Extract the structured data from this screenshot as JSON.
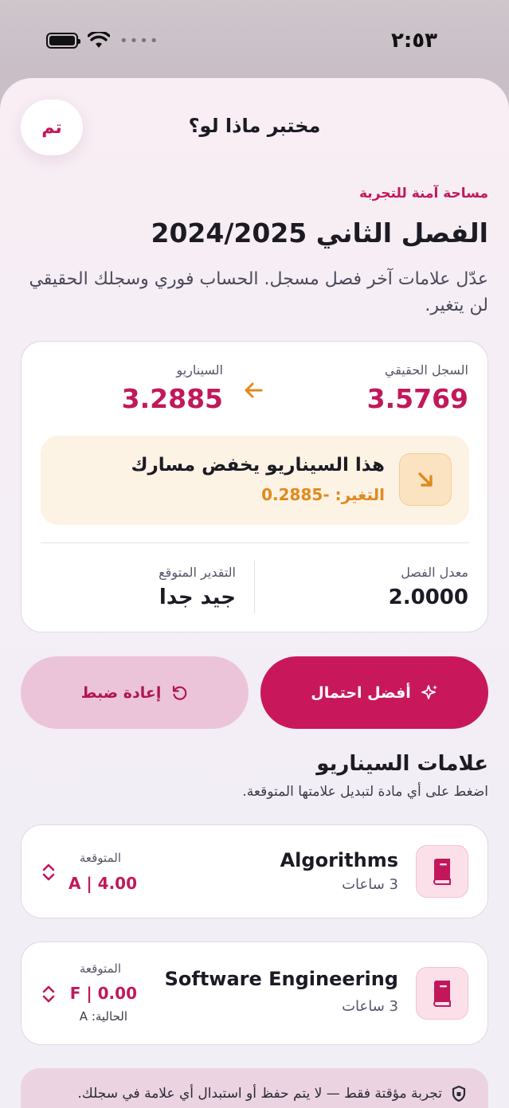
{
  "status": {
    "time": "٢:٥٣"
  },
  "header": {
    "done_label": "تم",
    "title": "مختبر ماذا لو؟"
  },
  "intro": {
    "overline": "مساحة آمنة للتجربة",
    "semester": "الفصل الثاني 2024/2025",
    "subtitle": "عدّل علامات آخر فصل مسجل. الحساب فوري وسجلك الحقيقي لن يتغير."
  },
  "summary": {
    "real_label": "السجل الحقيقي",
    "real_value": "3.5769",
    "scenario_label": "السيناريو",
    "scenario_value": "3.2885",
    "alert_title": "هذا السيناريو يخفض مسارك",
    "alert_change": "التغير: -0.2885",
    "avg_label": "معدل الفصل",
    "avg_value": "2.0000",
    "grade_label": "التقدير المتوقع",
    "grade_value": "جيد جدا"
  },
  "actions": {
    "best_label": "أفضل احتمال",
    "reset_label": "إعادة ضبط"
  },
  "grades_section": {
    "title": "علامات السيناريو",
    "subtitle": "اضغط على أي مادة لتبديل علامتها المتوقعة."
  },
  "courses": [
    {
      "name": "Algorithms",
      "hours": "3 ساعات",
      "expected_label": "المتوقعة",
      "expected_value": "A | 4.00"
    },
    {
      "name": "Software Engineering",
      "hours": "3 ساعات",
      "expected_label": "المتوقعة",
      "expected_value": "F | 0.00",
      "current_label": "الحالية: A"
    }
  ],
  "footer": {
    "note": "تجربة مؤقتة فقط — لا يتم حفظ أو استبدال أي علامة في سجلك."
  },
  "colors": {
    "accent": "#c2185b",
    "warning": "#e08a1e",
    "reset_bg": "#ecc4da"
  }
}
